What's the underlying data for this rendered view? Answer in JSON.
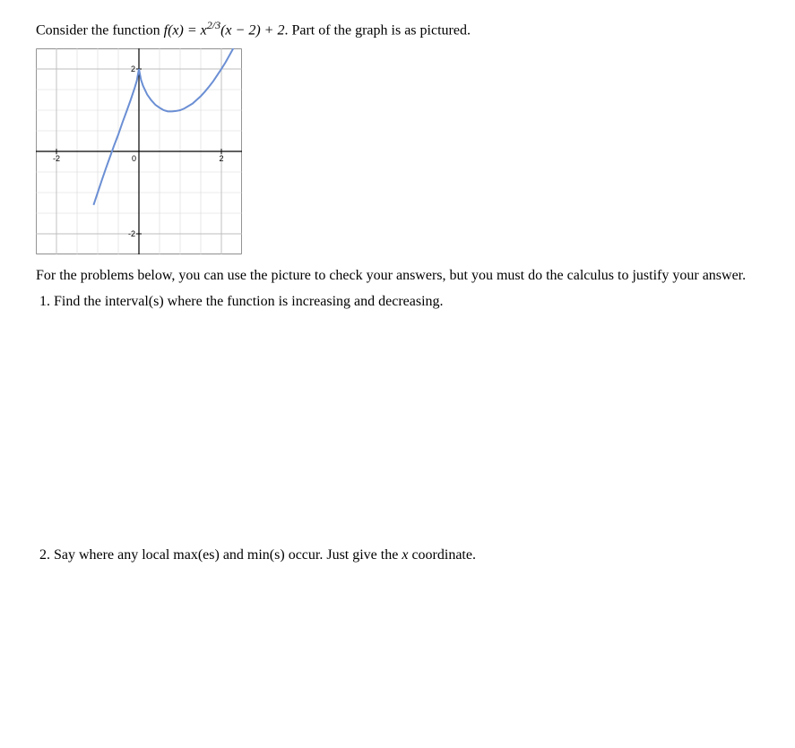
{
  "intro_prefix": "Consider the function ",
  "intro_func_lhs": "f(x) = x",
  "intro_exp": "2/3",
  "intro_func_rhs": "(x − 2) + 2",
  "intro_suffix": ". Part of the graph is as pictured.",
  "paragraph": "For the problems below, you can use the picture to check your answers, but you must do the calculus to justify your answer.",
  "q1": "Find the interval(s) where the function is increasing and decreasing.",
  "q2": "Say where any local max(es) and min(s) occur. Just give the x coordinate.",
  "q2_var": "x",
  "chart_data": {
    "type": "line",
    "title": "",
    "xlabel": "",
    "ylabel": "",
    "xlim": [
      -2.5,
      2.5
    ],
    "ylim": [
      -2.5,
      2.5
    ],
    "x_ticks": [
      -2,
      0,
      2
    ],
    "y_ticks": [
      -2,
      0,
      2
    ],
    "grid": true,
    "function": "x^(2/3)*(x-2)+2",
    "series": [
      {
        "name": "f(x)",
        "color": "#6b8fd4",
        "x": [
          -1.1,
          -1.0,
          -0.9,
          -0.8,
          -0.7,
          -0.6,
          -0.5,
          -0.4,
          -0.3,
          -0.2,
          -0.1,
          -0.05,
          0.0,
          0.05,
          0.1,
          0.2,
          0.3,
          0.4,
          0.5,
          0.6,
          0.7,
          0.8,
          0.9,
          1.0,
          1.1,
          1.2,
          1.3,
          1.4,
          1.5,
          1.6,
          1.7,
          1.8,
          1.9,
          2.0,
          2.1,
          2.2,
          2.3,
          2.4,
          2.5
        ],
        "y": [
          -1.3,
          -1.0,
          -0.7,
          -0.41,
          -0.13,
          0.15,
          0.41,
          0.7,
          0.97,
          1.25,
          1.55,
          1.72,
          2.0,
          1.74,
          1.59,
          1.38,
          1.24,
          1.13,
          1.06,
          1.0,
          0.97,
          0.97,
          0.98,
          1.0,
          1.04,
          1.1,
          1.16,
          1.25,
          1.34,
          1.45,
          1.57,
          1.7,
          1.85,
          2.0,
          2.16,
          2.34,
          2.52,
          2.72,
          2.92
        ]
      }
    ]
  }
}
